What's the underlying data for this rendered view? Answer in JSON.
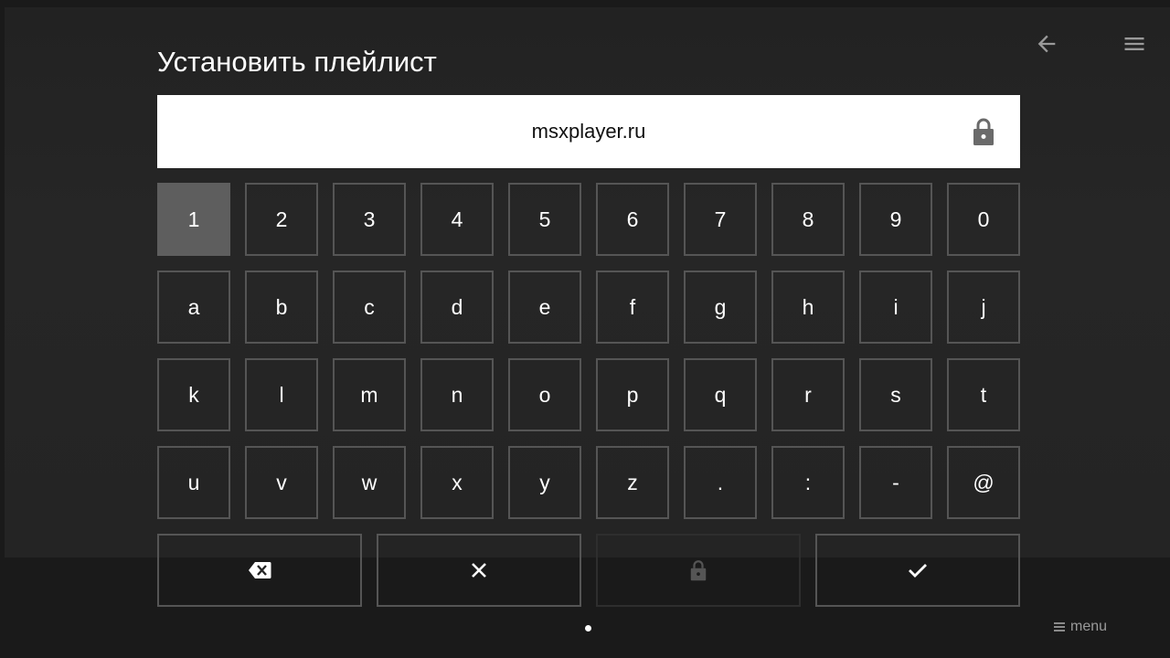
{
  "dialog": {
    "title": "Установить плейлист"
  },
  "header": {
    "back_icon": "arrow-left-icon",
    "menu_icon": "hamburger-menu-icon"
  },
  "input": {
    "value": "msxplayer.ru",
    "lock_icon": "lock-icon"
  },
  "keyboard": {
    "rows": [
      [
        "1",
        "2",
        "3",
        "4",
        "5",
        "6",
        "7",
        "8",
        "9",
        "0"
      ],
      [
        "a",
        "b",
        "c",
        "d",
        "e",
        "f",
        "g",
        "h",
        "i",
        "j"
      ],
      [
        "k",
        "l",
        "m",
        "n",
        "o",
        "p",
        "q",
        "r",
        "s",
        "t"
      ],
      [
        "u",
        "v",
        "w",
        "x",
        "y",
        "z",
        ".",
        ":",
        "-",
        "@"
      ]
    ],
    "focused_key": "1",
    "actions": [
      {
        "id": "backspace",
        "icon": "backspace-icon",
        "enabled": true
      },
      {
        "id": "clear",
        "icon": "close-icon",
        "enabled": true
      },
      {
        "id": "lock",
        "icon": "lock-icon",
        "enabled": false
      },
      {
        "id": "confirm",
        "icon": "checkmark-icon",
        "enabled": true
      }
    ]
  },
  "footer": {
    "menu_label": "menu",
    "menu_icon": "hamburger-menu-icon",
    "page_indicator": "page-dot-icon"
  },
  "colors": {
    "background": "#1a1a1a",
    "panel": "#242424",
    "key_border": "#555555",
    "key_focused": "#5e5e5e",
    "input_background": "#ffffff",
    "text": "#ffffff",
    "muted_text": "#9a9a9a"
  }
}
